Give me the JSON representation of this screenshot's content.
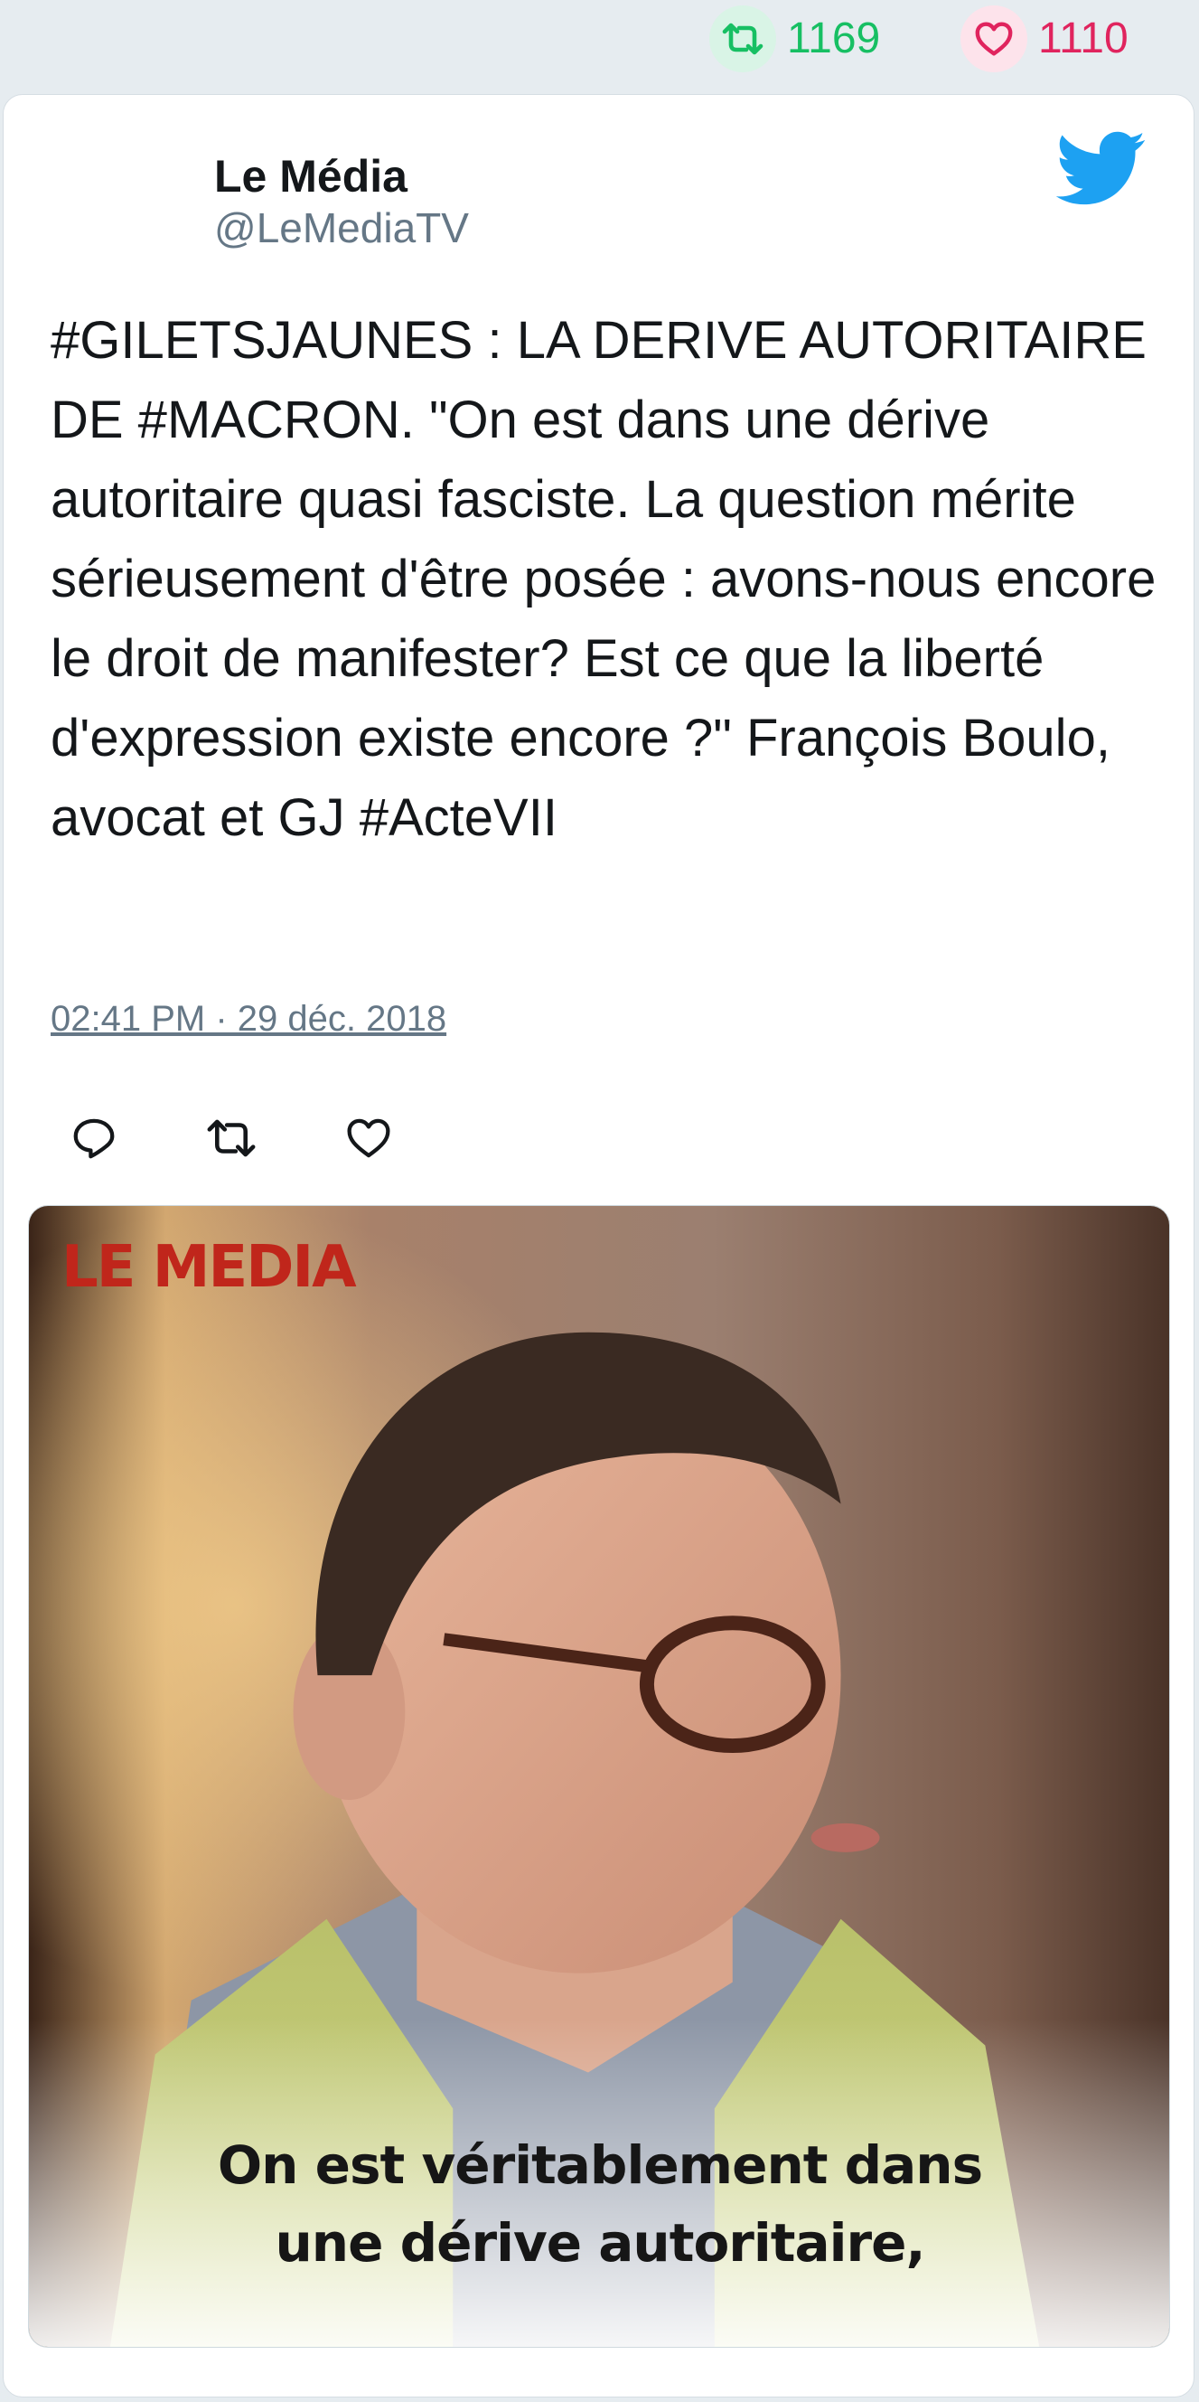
{
  "stats": {
    "retweet_count": "1169",
    "like_count": "1110",
    "retweet_icon": "retweet-icon",
    "like_icon": "heart-icon"
  },
  "tweet": {
    "author_name": "Le Média",
    "author_handle": "@LeMediaTV",
    "text": "#GILETSJAUNES : LA DERIVE AUTORITAIRE DE #MACRON. \"On est dans une dérive autoritaire quasi fasciste. La question mérite sérieusement d'être posée : avons-nous encore le droit de manifester? Est ce que la liberté d'expression existe encore ?\" François Boulo, avocat et GJ #ActeVII",
    "date": "02:41 PM · 29 déc. 2018",
    "logo_icon": "twitter-bird-icon",
    "actions": [
      "reply-icon",
      "retweet-icon",
      "like-icon"
    ]
  },
  "media": {
    "logo_text": "LE MEDIA",
    "caption_line1": "On est véritablement dans",
    "caption_line2": "une dérive autoritaire,"
  },
  "colors": {
    "background": "#e6ecf0",
    "retweet": "#17bf63",
    "like": "#e0245e",
    "twitter_blue": "#1da1f2",
    "muted": "#657786"
  }
}
